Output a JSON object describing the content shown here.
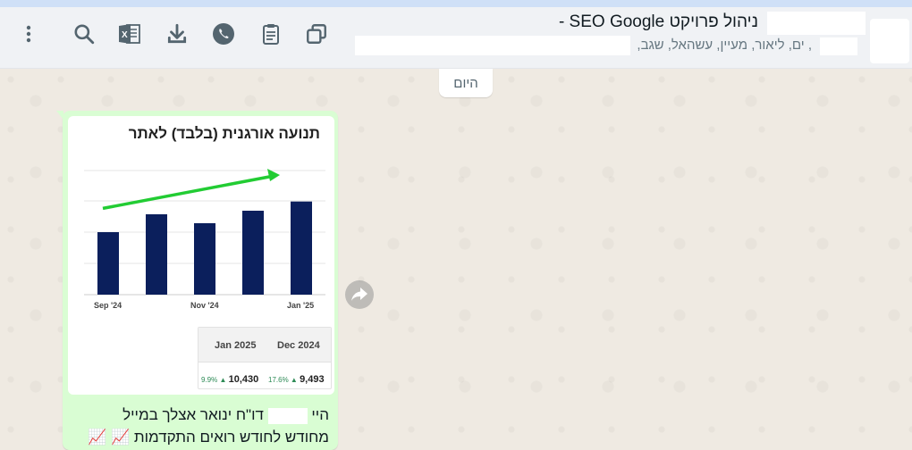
{
  "header": {
    "title": "ניהול פרויקט SEO Google -",
    "subtitle": ", ים, ליאור, מעיין, עשהאל, שגב,",
    "icons": [
      "more-icon",
      "search-icon",
      "excel-icon",
      "download-icon",
      "whatsapp-icon",
      "clipboard-icon",
      "copy-icon"
    ]
  },
  "date_separator": "היום",
  "message": {
    "image": {
      "title": "תנועה אורגנית (בלבד) לאתר",
      "chart_data": {
        "type": "bar",
        "categories": [
          "Sep '24",
          "",
          "Nov '24",
          "",
          "Jan '25"
        ],
        "values": [
          7000,
          9000,
          8000,
          9400,
          10430
        ],
        "ylim": [
          0,
          14000
        ],
        "grid": true,
        "annotation": "green arrow trending up",
        "colors": {
          "bar": "#0b1f5c",
          "arrow": "#22cc33"
        }
      },
      "stats": {
        "headers": [
          "Dec 2024",
          "Jan 2025"
        ],
        "values": [
          {
            "pct": "17.6%",
            "value": "9,493"
          },
          {
            "pct": "9.9%",
            "value": "10,430"
          }
        ]
      }
    },
    "line1_prefix": "היי",
    "line1_rest": "דו\"ח ינואר אצלך במייל",
    "line2": "מחודש לחודש רואים התקדמות 📈 📈"
  },
  "colors": {
    "bubble": "#d9fdd3",
    "header": "#f0f2f5",
    "chat_bg": "#efeae2"
  }
}
